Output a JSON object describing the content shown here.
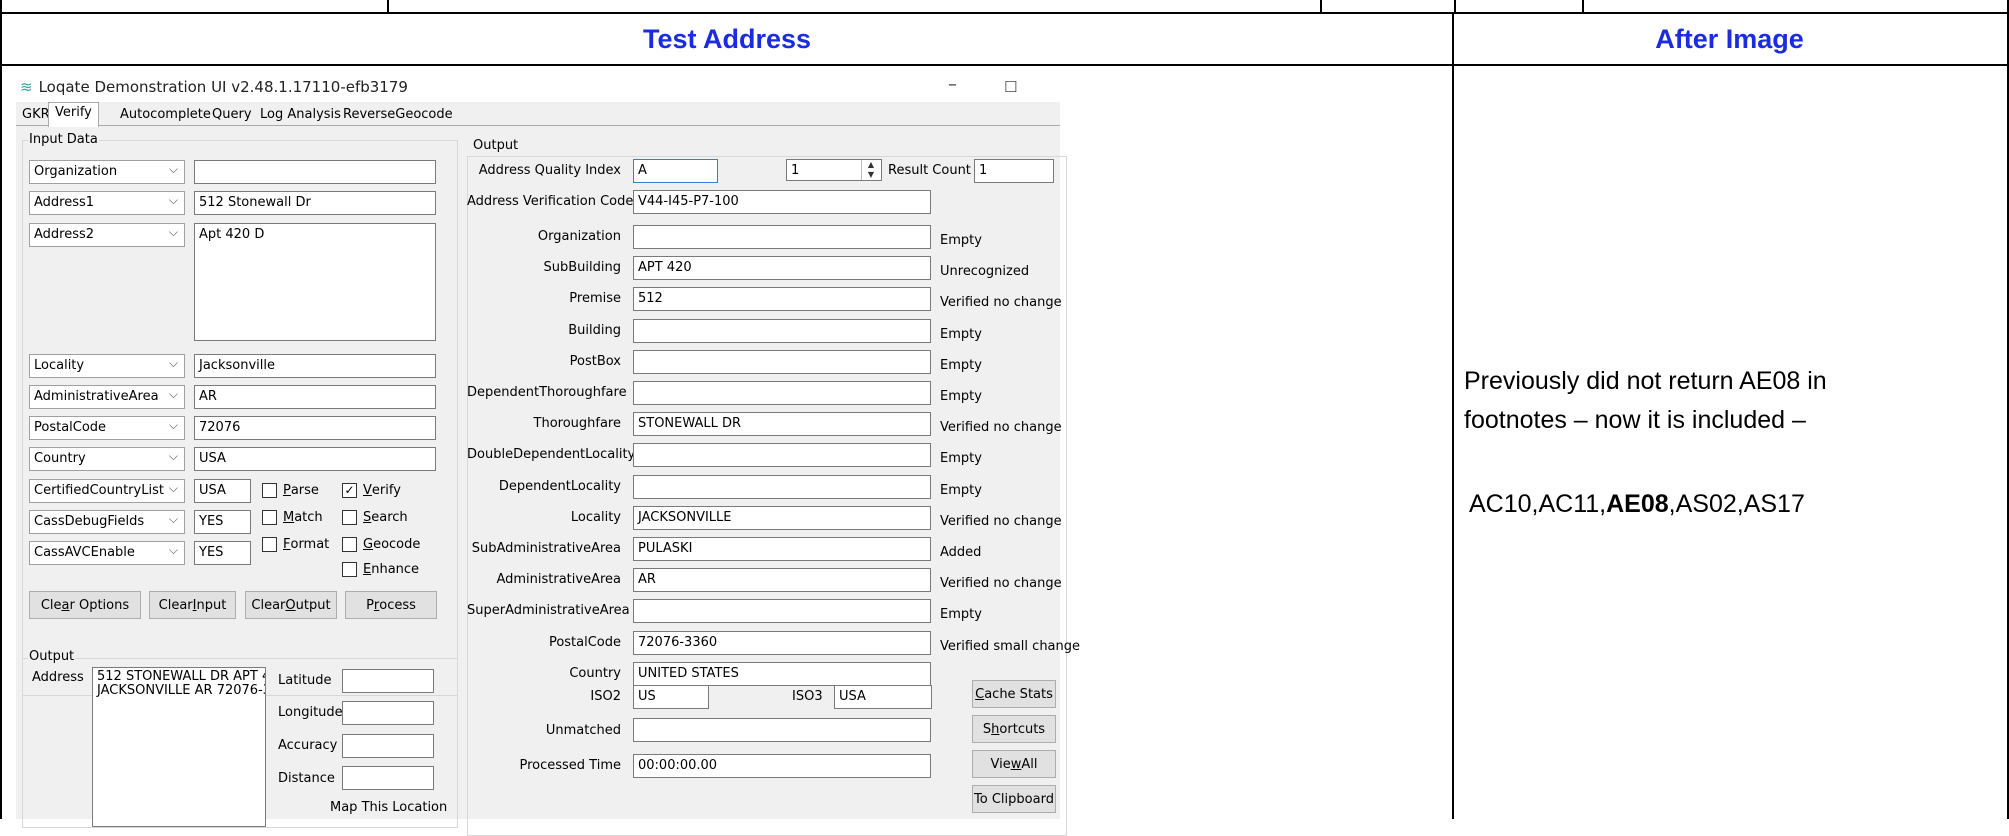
{
  "doc": {
    "header_left": "Test Address",
    "header_right": "After Image",
    "note_line1": "Previously did not return AE08 in",
    "note_line2": "footnotes – now it is included –",
    "codes_pre": "AC10,AC11,",
    "codes_bold": "AE08",
    "codes_post": ",AS02,AS17"
  },
  "app": {
    "title": "Loqate Demonstration UI v2.48.1.17110-efb3179",
    "minimize": "–",
    "maximize": "☐",
    "tabs": [
      "GKR",
      "Verify",
      "Autocomplete",
      "Query",
      "Log Analysis",
      "ReverseGeocode"
    ],
    "active_tab": "Verify",
    "input": {
      "group_label": "Input Data",
      "fields": [
        {
          "name": "Organization",
          "value": ""
        },
        {
          "name": "Address1",
          "value": "512 Stonewall Dr"
        },
        {
          "name": "Address2",
          "value": "Apt 420 D"
        },
        {
          "name": "Locality",
          "value": "Jacksonville"
        },
        {
          "name": "AdministrativeArea",
          "value": "AR"
        },
        {
          "name": "PostalCode",
          "value": "72076"
        },
        {
          "name": "Country",
          "value": "USA"
        },
        {
          "name": "CertifiedCountryList",
          "value": "USA"
        },
        {
          "name": "CassDebugFields",
          "value": "YES"
        },
        {
          "name": "CassAVCEnable",
          "value": "YES"
        }
      ],
      "checks": [
        {
          "pre": "",
          "ul": "P",
          "post": "arse",
          "checked": false
        },
        {
          "pre": "",
          "ul": "V",
          "post": "erify",
          "checked": true
        },
        {
          "pre": "",
          "ul": "M",
          "post": "atch",
          "checked": false
        },
        {
          "pre": "",
          "ul": "S",
          "post": "earch",
          "checked": false
        },
        {
          "pre": "",
          "ul": "F",
          "post": "ormat",
          "checked": false
        },
        {
          "pre": "",
          "ul": "G",
          "post": "eocode",
          "checked": false
        },
        {
          "pre": "",
          "ul": "E",
          "post": "nhance",
          "checked": false
        }
      ],
      "buttons": [
        {
          "pre": "Cle",
          "ul": "a",
          "post": "r Options"
        },
        {
          "pre": "Clear ",
          "ul": "I",
          "post": "nput"
        },
        {
          "pre": "Clear ",
          "ul": "O",
          "post": "utput"
        },
        {
          "pre": "P",
          "ul": "r",
          "post": "ocess"
        }
      ]
    },
    "output_left": {
      "group_label": "Output",
      "address_label": "Address",
      "address_line1": "512 STONEWALL DR APT 4",
      "address_line2": "JACKSONVILLE AR 72076-3",
      "latitude": "Latitude",
      "longitude": "Longitude",
      "accuracy": "Accuracy",
      "distance": "Distance",
      "map": "Map This Location"
    },
    "output_right": {
      "group_label": "Output",
      "aqi_label": "Address Quality Index",
      "aqi_value": "A",
      "spin_value": "1",
      "result_count_label": "Result Count",
      "result_count_value": "1",
      "avc_label": "Address Verification Code",
      "avc_value": "V44-I45-P7-100",
      "rows": [
        {
          "label": "Organization",
          "value": "",
          "status": "Empty"
        },
        {
          "label": "SubBuilding",
          "value": "APT 420",
          "status": "Unrecognized"
        },
        {
          "label": "Premise",
          "value": "512",
          "status": "Verified no change"
        },
        {
          "label": "Building",
          "value": "",
          "status": "Empty"
        },
        {
          "label": "PostBox",
          "value": "",
          "status": "Empty"
        },
        {
          "label": "DependentThoroughfare",
          "value": "",
          "status": "Empty"
        },
        {
          "label": "Thoroughfare",
          "value": "STONEWALL DR",
          "status": "Verified no change"
        },
        {
          "label": "DoubleDependentLocality",
          "value": "",
          "status": "Empty"
        },
        {
          "label": "DependentLocality",
          "value": "",
          "status": "Empty"
        },
        {
          "label": "Locality",
          "value": "JACKSONVILLE",
          "status": "Verified no change"
        },
        {
          "label": "SubAdministrativeArea",
          "value": "PULASKI",
          "status": "Added"
        },
        {
          "label": "AdministrativeArea",
          "value": "AR",
          "status": "Verified no change"
        },
        {
          "label": "SuperAdministrativeArea",
          "value": "",
          "status": "Empty"
        },
        {
          "label": "PostalCode",
          "value": "72076-3360",
          "status": "Verified small change"
        },
        {
          "label": "Country",
          "value": "UNITED STATES",
          "status": ""
        }
      ],
      "iso2_label": "ISO2",
      "iso2_value": "US",
      "iso3_label": "ISO3",
      "iso3_value": "USA",
      "unmatched_label": "Unmatched",
      "unmatched_value": "",
      "processed_label": "Processed Time",
      "processed_value": "00:00:00.00",
      "side_buttons": [
        {
          "pre": "",
          "ul": "C",
          "post": "ache Stats"
        },
        {
          "pre": "S",
          "ul": "h",
          "post": "ortcuts"
        },
        {
          "pre": "Vie",
          "ul": "w",
          "post": " All"
        },
        {
          "pre": "To Clipboard",
          "ul": "",
          "post": ""
        }
      ]
    }
  }
}
